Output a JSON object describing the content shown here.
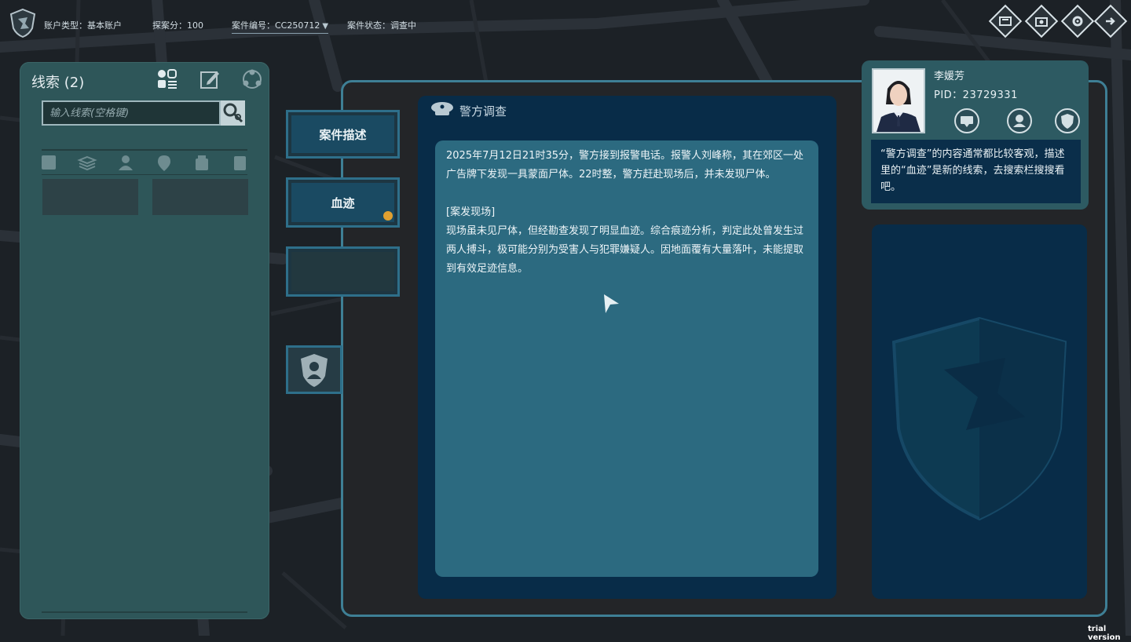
{
  "topbar": {
    "account_label": "账户类型：",
    "account_value": "基本账户",
    "score_label": "探案分：",
    "score_value": "100",
    "case_no_label": "案件编号：",
    "case_no_value": "CC250712",
    "status_label": "案件状态：",
    "status_value": "调查中",
    "buttons": [
      "files-icon",
      "camera-icon",
      "gear-icon",
      "exit-icon"
    ]
  },
  "clues": {
    "title": "线索 (2)",
    "search_placeholder": "输入线索(空格键)"
  },
  "tabs": {
    "case_description": "案件描述",
    "bloodstain": "血迹"
  },
  "document": {
    "title": "警方调查",
    "paragraph1": "2025年7月12日21时35分，警方接到报警电话。报警人刘峰称，其在郊区一处广告牌下发现一具蒙面尸体。22时整，警方赶赴现场后，并未发现尸体。",
    "section_heading": "[案发现场]",
    "paragraph2": "现场虽未见尸体，但经勘查发现了明显血迹。综合痕迹分析，判定此处曾发生过两人搏斗，极可能分别为受害人与犯罪嫌疑人。因地面覆有大量落叶，未能提取到有效足迹信息。"
  },
  "profile": {
    "name": "李媛芳",
    "pid": "PID：23729331",
    "hint": "“警方调查”的内容通常都比较客观，描述里的“血迹”是新的线索，去搜索栏搜搜看吧。"
  },
  "watermark": "trial version",
  "colors": {
    "frame": "#3e7f95",
    "panel_dark": "#082c48",
    "panel_text_bg": "#2c6a80",
    "clue_panel": "#2e5659",
    "badge": "#e0a030"
  }
}
